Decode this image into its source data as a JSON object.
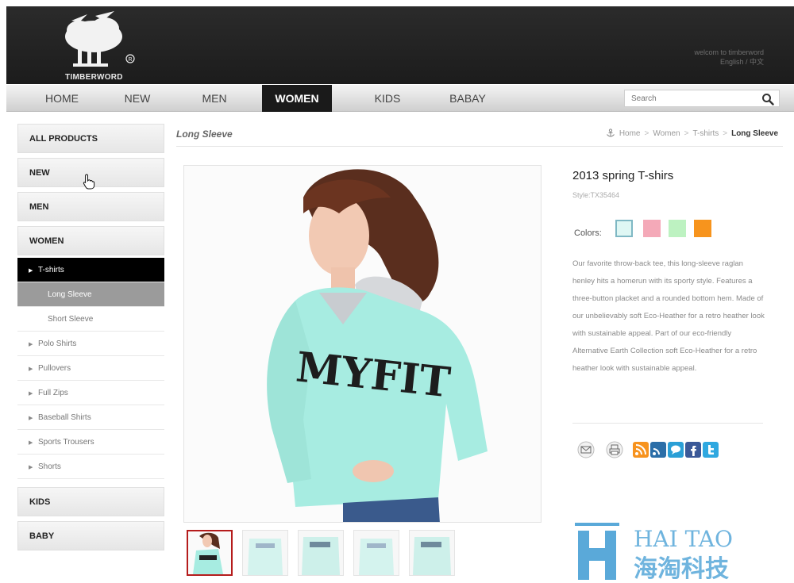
{
  "header": {
    "logo_text": "TIMBERWORD",
    "welcome_text": "welcom to timberword",
    "language_text": "English / 中文"
  },
  "nav": {
    "items": [
      "HOME",
      "NEW",
      "MEN",
      "WOMEN",
      "KIDS",
      "BABAY"
    ],
    "active": "WOMEN",
    "search_placeholder": "Search"
  },
  "sidebar": {
    "all_products": "ALL PRODUCTS",
    "new": "NEW",
    "men": "MEN",
    "women": "WOMEN",
    "sub_items": {
      "tshirts": "T-shirts",
      "long_sleeve": "Long Sleeve",
      "short_sleeve": "Short Sleeve",
      "polo": "Polo Shirts",
      "pullovers": "Pullovers",
      "full_zips": "Full Zips",
      "baseball": "Baseball Shirts",
      "sports": "Sports Trousers",
      "shorts": "Shorts"
    },
    "kids": "KIDS",
    "baby": "BABY"
  },
  "main": {
    "section_title": "Long Sleeve",
    "breadcrumb": [
      "Home",
      "Women",
      "T-shirts",
      "Long Sleeve"
    ],
    "shirt_print": "MYFIT"
  },
  "product": {
    "title": "2013 spring T-shirs",
    "style": "Style:TX35464",
    "colors_label": "Colors:",
    "colors": [
      "#dff7f4",
      "#f4a9b8",
      "#bdf2c1",
      "#f7941d"
    ],
    "description": "Our favorite throw-back tee, this long-sleeve raglan henley hits a homerun with its sporty style. Features a three-button placket and a rounded bottom hem. Made of our unbelievably soft Eco-Heather for a retro heather look with sustainable appeal. Part of our eco-friendly Alternative Earth Collection soft Eco-Heather for a retro heather look with sustainable appeal."
  },
  "watermark": {
    "latin": "HAI TAO",
    "chinese": "海淘科技"
  }
}
